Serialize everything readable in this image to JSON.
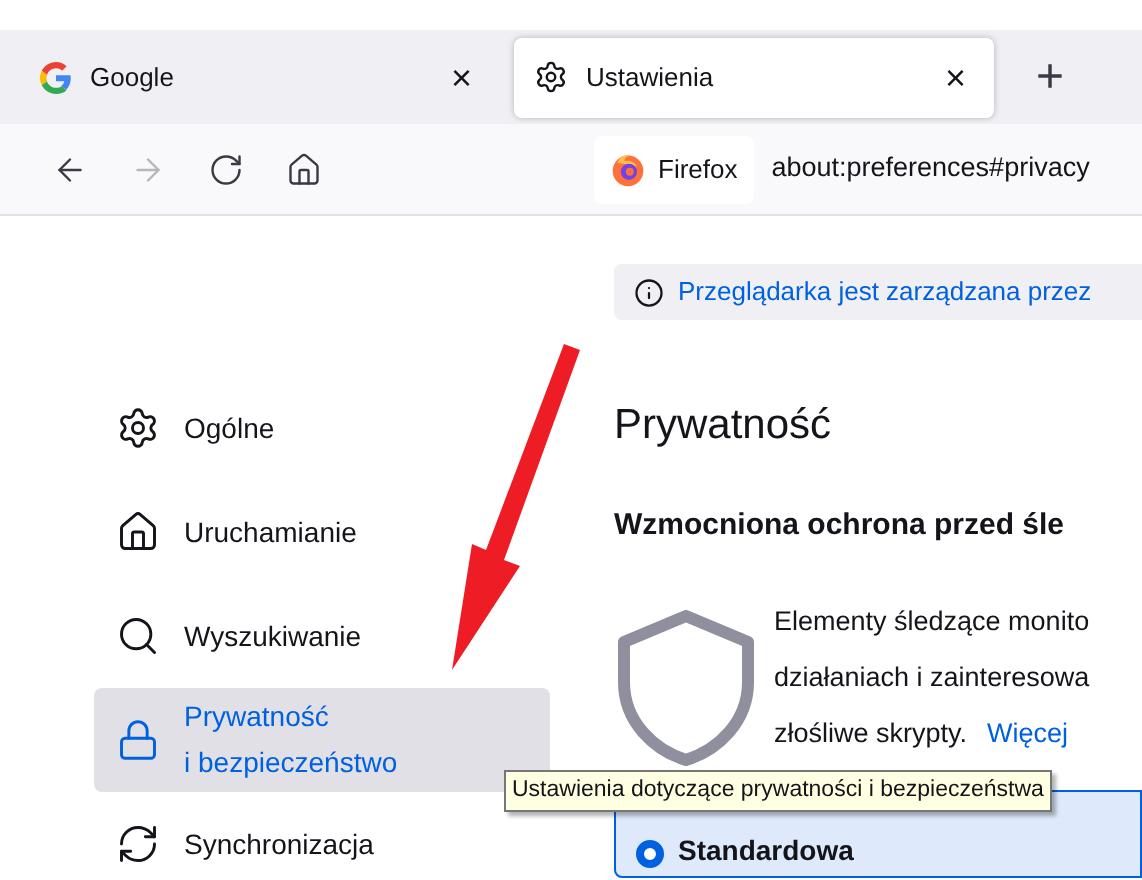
{
  "tabs": [
    {
      "kind": "google",
      "label": "Google",
      "selected": false,
      "close": "×"
    },
    {
      "kind": "settings",
      "label": "Ustawienia",
      "selected": true,
      "close": "×"
    }
  ],
  "new_tab": "+",
  "toolbar": {
    "nav": [
      {
        "kind": "back",
        "disabled": false
      },
      {
        "kind": "forward",
        "disabled": true
      },
      {
        "kind": "reload",
        "disabled": false
      },
      {
        "kind": "home",
        "disabled": false
      }
    ],
    "identity": "Firefox",
    "url": "about:preferences#privacy"
  },
  "sidebar": {
    "items": [
      {
        "kind": "gear",
        "label": "Ogólne",
        "selected": false
      },
      {
        "kind": "home",
        "label": "Uruchamianie",
        "selected": false
      },
      {
        "kind": "search",
        "label": "Wyszukiwanie",
        "selected": false
      },
      {
        "kind": "lock",
        "label": "Prywatność\ni bezpieczeństwo",
        "selected": true
      },
      {
        "kind": "sync",
        "label": "Synchronizacja",
        "selected": false
      }
    ]
  },
  "notice": "Przeglądarka jest zarządzana przez",
  "heading": "Prywatność",
  "section_title": "Wzmocniona ochrona przed śle",
  "description": [
    "Elementy śledzące monito",
    "działaniach i zainteresowa",
    "złośliwe skrypty."
  ],
  "more_link": "Więcej",
  "options": [
    {
      "label": "Standardowa",
      "selected": true
    }
  ],
  "tooltip": "Ustawienia dotyczące prywatności i bezpieczeństwa"
}
